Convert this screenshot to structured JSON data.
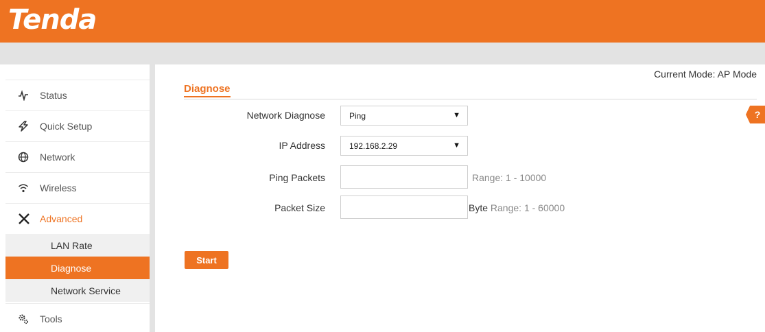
{
  "header": {
    "logo": "Tenda",
    "brand_color": "#ee7322"
  },
  "sidebar": {
    "items": [
      {
        "label": "Status",
        "icon": "pulse-icon"
      },
      {
        "label": "Quick Setup",
        "icon": "lightning-icon"
      },
      {
        "label": "Network",
        "icon": "globe-icon"
      },
      {
        "label": "Wireless",
        "icon": "wifi-icon"
      },
      {
        "label": "Advanced",
        "icon": "tools-icon",
        "active": true
      },
      {
        "label": "Tools",
        "icon": "gears-icon"
      }
    ],
    "sub_items": [
      {
        "label": "LAN Rate"
      },
      {
        "label": "Diagnose",
        "selected": true
      },
      {
        "label": "Network Service"
      }
    ]
  },
  "main": {
    "mode": "Current Mode: AP Mode",
    "title": "Diagnose",
    "help_label": "?",
    "form": {
      "network_diagnose": {
        "label": "Network Diagnose",
        "value": "Ping"
      },
      "ip_address": {
        "label": "IP Address",
        "value": "192.168.2.29"
      },
      "ping_packets": {
        "label": "Ping Packets",
        "value": "",
        "hint": "Range: 1 - 10000"
      },
      "packet_size": {
        "label": "Packet Size",
        "value": "",
        "unit": "Byte",
        "hint": "Range: 1 - 60000"
      }
    },
    "start_label": "Start"
  }
}
